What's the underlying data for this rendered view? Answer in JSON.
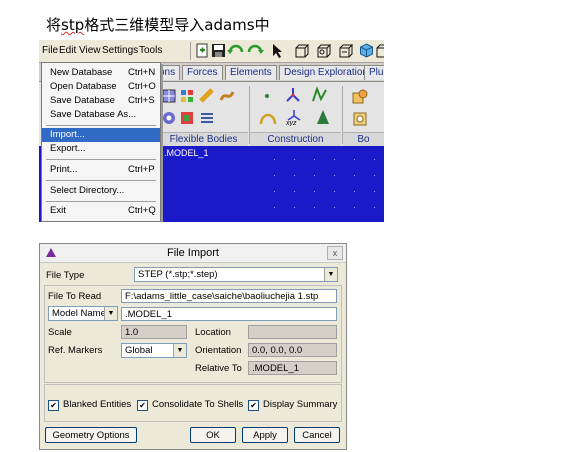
{
  "caption": {
    "prefix": "将",
    "underlined": "stp",
    "middle": "格式三维模型导入",
    "suffix": "adams",
    "tail": "中"
  },
  "menubar": {
    "items": [
      "File",
      "Edit",
      "View",
      "Settings",
      "Tools"
    ]
  },
  "ribbon": {
    "tabs": [
      "ons",
      "Forces",
      "Elements",
      "Design Exploration",
      "Plu"
    ],
    "groups": [
      "Flexible Bodies",
      "Construction",
      "Bo"
    ],
    "xyz_label": "xyz"
  },
  "canvas": {
    "model_label": ".MODEL_1",
    "color": "#1a1ac8"
  },
  "file_menu": {
    "items": [
      {
        "label": "New Database",
        "shortcut": "Ctrl+N"
      },
      {
        "label": "Open Database",
        "shortcut": "Ctrl+O"
      },
      {
        "label": "Save Database",
        "shortcut": "Ctrl+S"
      },
      {
        "label": "Save Database As...",
        "shortcut": ""
      },
      {
        "label": "Import...",
        "shortcut": ""
      },
      {
        "label": "Export...",
        "shortcut": ""
      },
      {
        "label": "Print...",
        "shortcut": "Ctrl+P"
      },
      {
        "label": "Select Directory...",
        "shortcut": ""
      },
      {
        "label": "Exit",
        "shortcut": "Ctrl+Q"
      }
    ],
    "highlight_color": "#316ac5"
  },
  "dialog": {
    "title": "File Import",
    "close": "x",
    "file_type_label": "File Type",
    "file_type_value": "STEP (*.stp;*.step)",
    "file_to_read_label": "File To Read",
    "file_to_read_value": "F:\\adams_little_case\\saiche\\baoliuchejia 1.stp",
    "model_name_select": "Model Name",
    "model_name_value": ".MODEL_1",
    "scale_label": "Scale",
    "scale_value": "1.0",
    "location_label": "Location",
    "location_value": "",
    "ref_markers_label": "Ref. Markers",
    "ref_markers_value": "Global",
    "orientation_label": "Orientation",
    "orientation_value": "0.0, 0.0, 0.0",
    "relative_to_label": "Relative To",
    "relative_to_value": ".MODEL_1",
    "checks": [
      {
        "label": "Blanked Entities",
        "checked": true
      },
      {
        "label": "Consolidate To Shells",
        "checked": true
      },
      {
        "label": "Display Summary",
        "checked": true
      }
    ],
    "buttons": {
      "geometry": "Geometry Options",
      "ok": "OK",
      "apply": "Apply",
      "cancel": "Cancel"
    }
  }
}
